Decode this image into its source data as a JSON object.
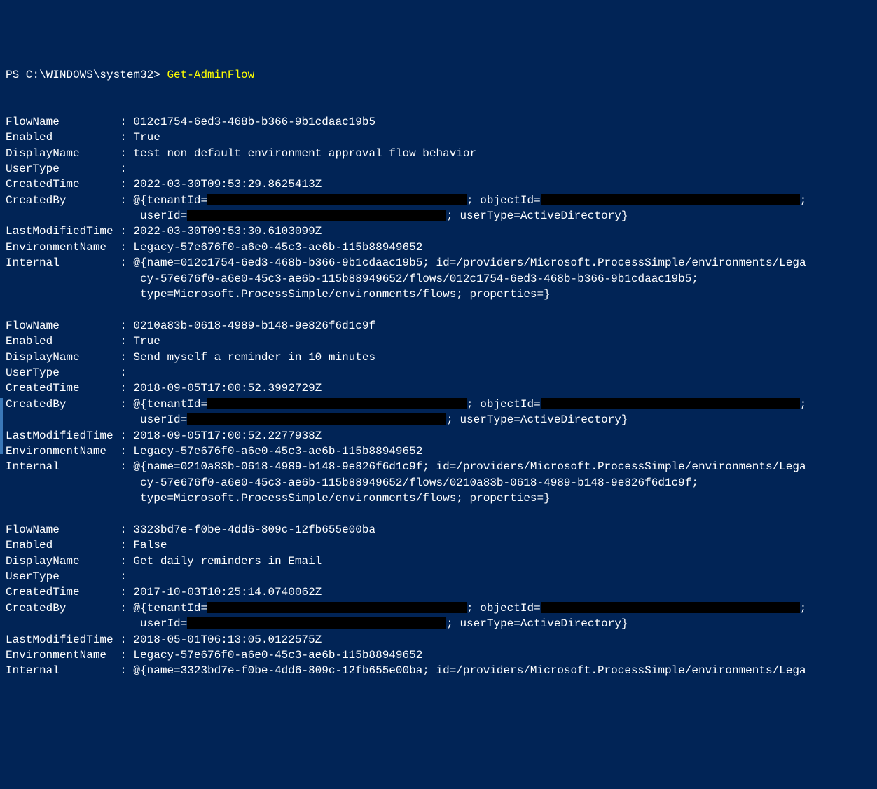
{
  "prompt": "PS C:\\WINDOWS\\system32> ",
  "command": "Get-AdminFlow",
  "labels": {
    "flowName": "FlowName",
    "enabled": "Enabled",
    "displayName": "DisplayName",
    "userType": "UserType",
    "createdTime": "CreatedTime",
    "createdBy": "CreatedBy",
    "lastModifiedTime": "LastModifiedTime",
    "environmentName": "EnvironmentName",
    "internal": "Internal"
  },
  "createdByFragments": {
    "pre": "@{tenantId=",
    "mid": "; objectId=",
    "post": ";",
    "userIdPre": "userId=",
    "userTypeSuffix": "; userType=ActiveDirectory}"
  },
  "flows": [
    {
      "flowName": "012c1754-6ed3-468b-b366-9b1cdaac19b5",
      "enabled": "True",
      "displayName": "test non default environment approval flow behavior",
      "userType": "",
      "createdTime": "2022-03-30T09:53:29.8625413Z",
      "lastModifiedTime": "2022-03-30T09:53:30.6103099Z",
      "environmentName": "Legacy-57e676f0-a6e0-45c3-ae6b-115b88949652",
      "internal1": "@{name=012c1754-6ed3-468b-b366-9b1cdaac19b5; id=/providers/Microsoft.ProcessSimple/environments/Lega",
      "internal2": "cy-57e676f0-a6e0-45c3-ae6b-115b88949652/flows/012c1754-6ed3-468b-b366-9b1cdaac19b5;",
      "internal3": "type=Microsoft.ProcessSimple/environments/flows; properties=}"
    },
    {
      "flowName": "0210a83b-0618-4989-b148-9e826f6d1c9f",
      "enabled": "True",
      "displayName": "Send myself a reminder in 10 minutes",
      "userType": "",
      "createdTime": "2018-09-05T17:00:52.3992729Z",
      "lastModifiedTime": "2018-09-05T17:00:52.2277938Z",
      "environmentName": "Legacy-57e676f0-a6e0-45c3-ae6b-115b88949652",
      "internal1": "@{name=0210a83b-0618-4989-b148-9e826f6d1c9f; id=/providers/Microsoft.ProcessSimple/environments/Lega",
      "internal2": "cy-57e676f0-a6e0-45c3-ae6b-115b88949652/flows/0210a83b-0618-4989-b148-9e826f6d1c9f;",
      "internal3": "type=Microsoft.ProcessSimple/environments/flows; properties=}"
    },
    {
      "flowName": "3323bd7e-f0be-4dd6-809c-12fb655e00ba",
      "enabled": "False",
      "displayName": "Get daily reminders in Email",
      "userType": "",
      "createdTime": "2017-10-03T10:25:14.0740062Z",
      "lastModifiedTime": "2018-05-01T06:13:05.0122575Z",
      "environmentName": "Legacy-57e676f0-a6e0-45c3-ae6b-115b88949652",
      "internal1": "@{name=3323bd7e-f0be-4dd6-809c-12fb655e00ba; id=/providers/Microsoft.ProcessSimple/environments/Lega",
      "internal2": "",
      "internal3": ""
    }
  ]
}
